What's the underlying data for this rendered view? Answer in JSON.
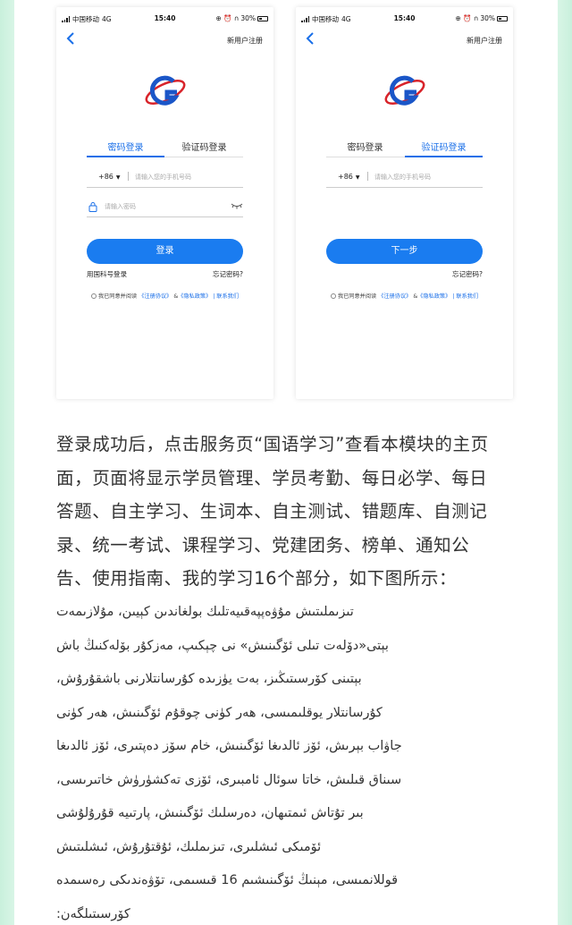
{
  "colors": {
    "accent": "#1a7cf0",
    "side_bg": "#c9f0dc"
  },
  "screens": [
    {
      "status": {
        "carrier": "中国移动",
        "network": "4G",
        "time": "15:40",
        "battery": "30%"
      },
      "header": {
        "back_icon": "chevron-left-icon",
        "new_user": "新用户注册"
      },
      "tabs": [
        "密码登录",
        "验证码登录"
      ],
      "active_tab": 0,
      "phone_field": {
        "country_code": "+86",
        "placeholder": "请输入您的手机号码"
      },
      "password_field": {
        "placeholder": "请输入密码"
      },
      "primary_button": "登录",
      "link_left": "用国科号登录",
      "link_right": "忘记密码?",
      "agreement": {
        "prefix": "我已同意并阅读",
        "terms": "《注册协议》",
        "amp": "&",
        "privacy": "《隐私政策》",
        "sep": "|",
        "contact": "联系我们"
      }
    },
    {
      "status": {
        "carrier": "中国移动",
        "network": "4G",
        "time": "15:40",
        "battery": "30%"
      },
      "header": {
        "back_icon": "chevron-left-icon",
        "new_user": "新用户注册"
      },
      "tabs": [
        "密码登录",
        "验证码登录"
      ],
      "active_tab": 1,
      "phone_field": {
        "country_code": "+86",
        "placeholder": "请输入您的手机号码"
      },
      "primary_button": "下一步",
      "link_left": "",
      "link_right": "忘记密码?",
      "agreement": {
        "prefix": "我已同意并阅读",
        "terms": "《注册协议》",
        "amp": "&",
        "privacy": "《隐私政策》",
        "sep": "|",
        "contact": "联系我们"
      }
    }
  ],
  "article": {
    "chinese_lines": [
      "登录成功后，点击服务页“国语学习”查看本模块的主页",
      "面，页面将显示学员管理、学员考勤、每日必学、每日",
      "答题、自主学习、生词本、自主测试、错题库、自测记",
      "录、统一考试、课程学习、党建团务、榜单、通知公",
      "告、使用指南、我的学习16个部分，如下图所示："
    ],
    "uyghur_lines": [
      "تىزىملىتىش مۇۋەپپەقىيەتلىك بولغاندىن كېيىن، مۇلازىمەت",
      "بېتى«دۆلەت تىلى ئۆگىنىش» نى چېكىپ، مەزكۇر بۆلەكنىڭ باش",
      "بېتىنى كۆرسىتىڭىز، بەت يۈزىدە كۇرسانتلارنى باشقۇرۇش،",
      "كۇرسانتلار يوقلىمىسى، ھەر كۈنى چوقۇم ئۆگىنىش، ھەر كۈنى",
      "جاۋاب بېرىش، ئۆز ئالدىغا ئۆگىنىش، خام سۆز دەپتىرى، ئۆز ئالدىغا",
      "سىناق قىلىش، خاتا سوئال ئامبىرى، ئۆزى تەكشۈرۈش خاتىرىسى،",
      "بىر تۇتاش ئىمتىھان، دەرسلىك ئۆگىنىش، پارتىيە قۇرۇلۇشى",
      "ئۆمىكى ئىشلىرى، تىزىملىك، ئۇقتۇرۇش، ئىشلىتىش",
      "قوللانمىسى، مېنىڭ ئۆگىنىشىم 16 قىسىمى، تۆۋەندىكى رەسىمدە",
      "كۆرسىتىلگەن:"
    ]
  }
}
